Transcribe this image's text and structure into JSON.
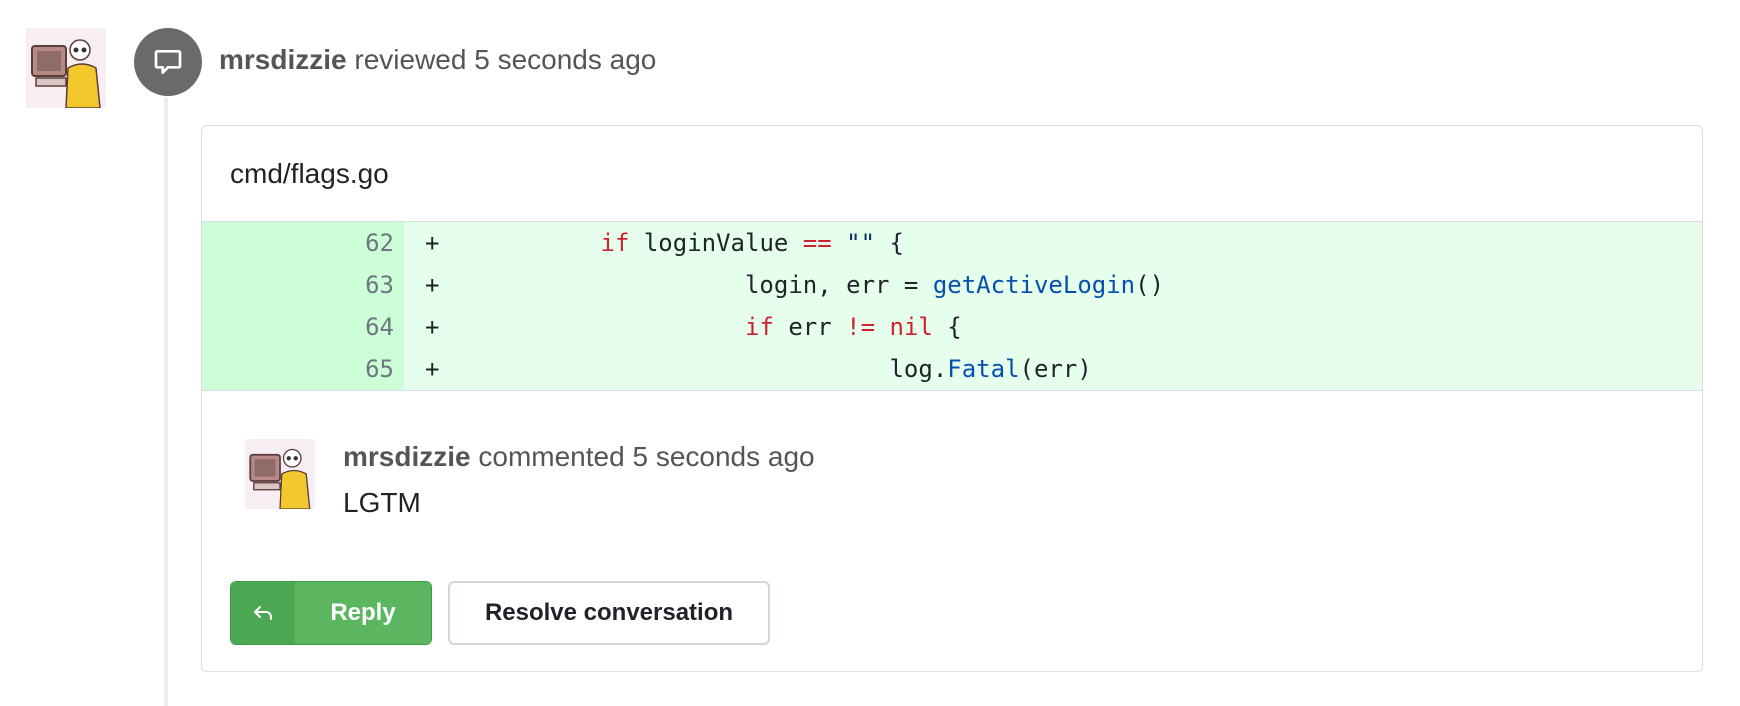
{
  "review": {
    "user": "mrsdizzie",
    "action": "reviewed",
    "time": "5 seconds ago"
  },
  "file": {
    "path": "cmd/flags.go"
  },
  "diff": [
    {
      "line": "62",
      "marker": "+"
    },
    {
      "line": "63",
      "marker": "+"
    },
    {
      "line": "64",
      "marker": "+"
    },
    {
      "line": "65",
      "marker": "+"
    }
  ],
  "code": {
    "l62_kw1": "if",
    "l62_txt1": " loginValue ",
    "l62_op": "==",
    "l62_sp": " ",
    "l62_str": "\"\"",
    "l62_brace": " {",
    "l63_txt1": "login, err = ",
    "l63_fn": "getActiveLogin",
    "l63_txt2": "()",
    "l64_kw1": "if",
    "l64_txt1": " err ",
    "l64_op": "!=",
    "l64_sp": " ",
    "l64_kw2": "nil",
    "l64_brace": " {",
    "l65_txt1": "log.",
    "l65_fn": "Fatal",
    "l65_txt2": "(err)"
  },
  "comment": {
    "user": "mrsdizzie",
    "action": "commented",
    "time": "5 seconds ago",
    "body": "LGTM"
  },
  "buttons": {
    "reply": "Reply",
    "resolve": "Resolve conversation"
  },
  "colors": {
    "added_bg": "#e6ffec",
    "added_ln_bg": "#ccffd8",
    "reply_green": "#5bb65f"
  }
}
